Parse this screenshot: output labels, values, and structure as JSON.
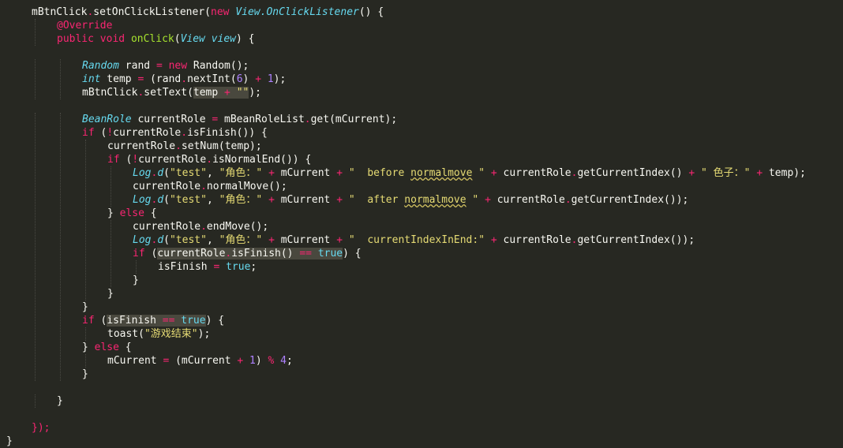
{
  "theme": {
    "background": "#272822",
    "plain": "#f8f8f2",
    "keyword": "#f92672",
    "type": "#66d9ef",
    "method": "#a6e22e",
    "string": "#e6db74",
    "number": "#ae81ff",
    "annotation": "#f92672",
    "highlight": "#49483e"
  },
  "code_lines": [
    {
      "indent": 1,
      "tokens": [
        {
          "t": "mBtnClick",
          "c": "plain"
        },
        {
          "t": ".",
          "c": "keyword"
        },
        {
          "t": "setOnClickListener(",
          "c": "plain"
        },
        {
          "t": "new",
          "c": "keyword"
        },
        {
          "t": " ",
          "c": "plain"
        },
        {
          "t": "View.OnClickListener",
          "c": "type",
          "i": true
        },
        {
          "t": "() {",
          "c": "plain"
        }
      ]
    },
    {
      "indent": 2,
      "tokens": [
        {
          "t": "@Override",
          "c": "annotation"
        }
      ]
    },
    {
      "indent": 2,
      "tokens": [
        {
          "t": "public",
          "c": "keyword"
        },
        {
          "t": " ",
          "c": "plain"
        },
        {
          "t": "void",
          "c": "keyword"
        },
        {
          "t": " ",
          "c": "plain"
        },
        {
          "t": "onClick",
          "c": "method"
        },
        {
          "t": "(",
          "c": "plain"
        },
        {
          "t": "View",
          "c": "type",
          "i": true
        },
        {
          "t": " ",
          "c": "plain"
        },
        {
          "t": "view",
          "c": "type",
          "i": true
        },
        {
          "t": ") {",
          "c": "plain"
        }
      ]
    },
    {
      "indent": 0,
      "tokens": []
    },
    {
      "indent": 3,
      "tokens": [
        {
          "t": "Random",
          "c": "type",
          "i": true
        },
        {
          "t": " rand ",
          "c": "plain"
        },
        {
          "t": "=",
          "c": "keyword"
        },
        {
          "t": " ",
          "c": "plain"
        },
        {
          "t": "new",
          "c": "keyword"
        },
        {
          "t": " Random();",
          "c": "plain"
        }
      ]
    },
    {
      "indent": 3,
      "tokens": [
        {
          "t": "int",
          "c": "type",
          "i": true
        },
        {
          "t": " temp ",
          "c": "plain"
        },
        {
          "t": "=",
          "c": "keyword"
        },
        {
          "t": " (rand",
          "c": "plain"
        },
        {
          "t": ".",
          "c": "keyword"
        },
        {
          "t": "nextInt(",
          "c": "plain"
        },
        {
          "t": "6",
          "c": "number"
        },
        {
          "t": ") ",
          "c": "plain"
        },
        {
          "t": "+",
          "c": "keyword"
        },
        {
          "t": " ",
          "c": "plain"
        },
        {
          "t": "1",
          "c": "number"
        },
        {
          "t": ");",
          "c": "plain"
        }
      ]
    },
    {
      "indent": 3,
      "tokens": [
        {
          "t": "mBtnClick",
          "c": "plain"
        },
        {
          "t": ".",
          "c": "keyword"
        },
        {
          "t": "setText(",
          "c": "plain"
        },
        {
          "t": "temp ",
          "c": "plain",
          "h": true
        },
        {
          "t": "+",
          "c": "keyword",
          "h": true
        },
        {
          "t": " ",
          "c": "plain",
          "h": true
        },
        {
          "t": "\"\"",
          "c": "string",
          "h": true
        },
        {
          "t": ");",
          "c": "plain"
        }
      ]
    },
    {
      "indent": 0,
      "tokens": []
    },
    {
      "indent": 3,
      "tokens": [
        {
          "t": "BeanRole",
          "c": "type",
          "i": true
        },
        {
          "t": " currentRole ",
          "c": "plain"
        },
        {
          "t": "=",
          "c": "keyword"
        },
        {
          "t": " mBeanRoleList",
          "c": "plain"
        },
        {
          "t": ".",
          "c": "keyword"
        },
        {
          "t": "get(mCurrent);",
          "c": "plain"
        }
      ]
    },
    {
      "indent": 3,
      "tokens": [
        {
          "t": "if",
          "c": "keyword"
        },
        {
          "t": " (",
          "c": "plain"
        },
        {
          "t": "!",
          "c": "keyword"
        },
        {
          "t": "currentRole",
          "c": "plain"
        },
        {
          "t": ".",
          "c": "keyword"
        },
        {
          "t": "isFinish()) {",
          "c": "plain"
        }
      ]
    },
    {
      "indent": 4,
      "tokens": [
        {
          "t": "currentRole",
          "c": "plain"
        },
        {
          "t": ".",
          "c": "keyword"
        },
        {
          "t": "setNum(temp);",
          "c": "plain"
        }
      ]
    },
    {
      "indent": 4,
      "tokens": [
        {
          "t": "if",
          "c": "keyword"
        },
        {
          "t": " (",
          "c": "plain"
        },
        {
          "t": "!",
          "c": "keyword"
        },
        {
          "t": "currentRole",
          "c": "plain"
        },
        {
          "t": ".",
          "c": "keyword"
        },
        {
          "t": "isNormalEnd()) {",
          "c": "plain"
        }
      ]
    },
    {
      "indent": 5,
      "tokens": [
        {
          "t": "Log",
          "c": "type",
          "i": true
        },
        {
          "t": ".",
          "c": "keyword"
        },
        {
          "t": "d",
          "c": "type",
          "i": true
        },
        {
          "t": "(",
          "c": "plain"
        },
        {
          "t": "\"test\"",
          "c": "string"
        },
        {
          "t": ", ",
          "c": "plain"
        },
        {
          "t": "\"角色：\"",
          "c": "string"
        },
        {
          "t": " ",
          "c": "plain"
        },
        {
          "t": "+",
          "c": "keyword"
        },
        {
          "t": " mCurrent ",
          "c": "plain"
        },
        {
          "t": "+",
          "c": "keyword"
        },
        {
          "t": " ",
          "c": "plain"
        },
        {
          "t": "\"  before ",
          "c": "string"
        },
        {
          "t": "normalmove",
          "c": "string",
          "u": true
        },
        {
          "t": " \"",
          "c": "string"
        },
        {
          "t": " ",
          "c": "plain"
        },
        {
          "t": "+",
          "c": "keyword"
        },
        {
          "t": " currentRole",
          "c": "plain"
        },
        {
          "t": ".",
          "c": "keyword"
        },
        {
          "t": "getCurrentIndex() ",
          "c": "plain"
        },
        {
          "t": "+",
          "c": "keyword"
        },
        {
          "t": " ",
          "c": "plain"
        },
        {
          "t": "\" 色子：\"",
          "c": "string"
        },
        {
          "t": " ",
          "c": "plain"
        },
        {
          "t": "+",
          "c": "keyword"
        },
        {
          "t": " temp);",
          "c": "plain"
        }
      ]
    },
    {
      "indent": 5,
      "tokens": [
        {
          "t": "currentRole",
          "c": "plain"
        },
        {
          "t": ".",
          "c": "keyword"
        },
        {
          "t": "normalMove();",
          "c": "plain"
        }
      ]
    },
    {
      "indent": 5,
      "tokens": [
        {
          "t": "Log",
          "c": "type",
          "i": true
        },
        {
          "t": ".",
          "c": "keyword"
        },
        {
          "t": "d",
          "c": "type",
          "i": true
        },
        {
          "t": "(",
          "c": "plain"
        },
        {
          "t": "\"test\"",
          "c": "string"
        },
        {
          "t": ", ",
          "c": "plain"
        },
        {
          "t": "\"角色：\"",
          "c": "string"
        },
        {
          "t": " ",
          "c": "plain"
        },
        {
          "t": "+",
          "c": "keyword"
        },
        {
          "t": " mCurrent ",
          "c": "plain"
        },
        {
          "t": "+",
          "c": "keyword"
        },
        {
          "t": " ",
          "c": "plain"
        },
        {
          "t": "\"  after ",
          "c": "string"
        },
        {
          "t": "normalmove",
          "c": "string",
          "u": true
        },
        {
          "t": " \"",
          "c": "string"
        },
        {
          "t": " ",
          "c": "plain"
        },
        {
          "t": "+",
          "c": "keyword"
        },
        {
          "t": " currentRole",
          "c": "plain"
        },
        {
          "t": ".",
          "c": "keyword"
        },
        {
          "t": "getCurrentIndex());",
          "c": "plain"
        }
      ]
    },
    {
      "indent": 4,
      "tokens": [
        {
          "t": "} ",
          "c": "plain"
        },
        {
          "t": "else",
          "c": "keyword"
        },
        {
          "t": " {",
          "c": "plain"
        }
      ]
    },
    {
      "indent": 5,
      "tokens": [
        {
          "t": "currentRole",
          "c": "plain"
        },
        {
          "t": ".",
          "c": "keyword"
        },
        {
          "t": "endMove();",
          "c": "plain"
        }
      ]
    },
    {
      "indent": 5,
      "tokens": [
        {
          "t": "Log",
          "c": "type",
          "i": true
        },
        {
          "t": ".",
          "c": "keyword"
        },
        {
          "t": "d",
          "c": "type",
          "i": true
        },
        {
          "t": "(",
          "c": "plain"
        },
        {
          "t": "\"test\"",
          "c": "string"
        },
        {
          "t": ", ",
          "c": "plain"
        },
        {
          "t": "\"角色：\"",
          "c": "string"
        },
        {
          "t": " ",
          "c": "plain"
        },
        {
          "t": "+",
          "c": "keyword"
        },
        {
          "t": " mCurrent ",
          "c": "plain"
        },
        {
          "t": "+",
          "c": "keyword"
        },
        {
          "t": " ",
          "c": "plain"
        },
        {
          "t": "\"  currentIndexInEnd:\"",
          "c": "string"
        },
        {
          "t": " ",
          "c": "plain"
        },
        {
          "t": "+",
          "c": "keyword"
        },
        {
          "t": " currentRole",
          "c": "plain"
        },
        {
          "t": ".",
          "c": "keyword"
        },
        {
          "t": "getCurrentIndex());",
          "c": "plain"
        }
      ]
    },
    {
      "indent": 5,
      "tokens": [
        {
          "t": "if",
          "c": "keyword"
        },
        {
          "t": " (",
          "c": "plain"
        },
        {
          "t": "currentRole",
          "c": "plain",
          "h": true
        },
        {
          "t": ".",
          "c": "keyword",
          "h": true
        },
        {
          "t": "isFinish() ",
          "c": "plain",
          "h": true
        },
        {
          "t": "==",
          "c": "keyword",
          "h": true
        },
        {
          "t": " ",
          "c": "plain",
          "h": true
        },
        {
          "t": "true",
          "c": "type",
          "h": true
        },
        {
          "t": ") {",
          "c": "plain"
        }
      ]
    },
    {
      "indent": 6,
      "tokens": [
        {
          "t": "isFinish ",
          "c": "plain"
        },
        {
          "t": "=",
          "c": "keyword"
        },
        {
          "t": " ",
          "c": "plain"
        },
        {
          "t": "true",
          "c": "type"
        },
        {
          "t": ";",
          "c": "plain"
        }
      ]
    },
    {
      "indent": 5,
      "tokens": [
        {
          "t": "}",
          "c": "plain"
        }
      ]
    },
    {
      "indent": 4,
      "tokens": [
        {
          "t": "}",
          "c": "plain"
        }
      ]
    },
    {
      "indent": 3,
      "tokens": [
        {
          "t": "}",
          "c": "plain"
        }
      ]
    },
    {
      "indent": 3,
      "tokens": [
        {
          "t": "if",
          "c": "keyword"
        },
        {
          "t": " (",
          "c": "plain"
        },
        {
          "t": "isFinish ",
          "c": "plain",
          "h": true
        },
        {
          "t": "==",
          "c": "keyword",
          "h": true
        },
        {
          "t": " ",
          "c": "plain",
          "h": true
        },
        {
          "t": "true",
          "c": "type",
          "h": true
        },
        {
          "t": ") {",
          "c": "plain"
        }
      ]
    },
    {
      "indent": 4,
      "tokens": [
        {
          "t": "toast(",
          "c": "plain"
        },
        {
          "t": "\"游戏结束\"",
          "c": "string"
        },
        {
          "t": ");",
          "c": "plain"
        }
      ]
    },
    {
      "indent": 3,
      "tokens": [
        {
          "t": "} ",
          "c": "plain"
        },
        {
          "t": "else",
          "c": "keyword"
        },
        {
          "t": " {",
          "c": "plain"
        }
      ]
    },
    {
      "indent": 4,
      "tokens": [
        {
          "t": "mCurrent ",
          "c": "plain"
        },
        {
          "t": "=",
          "c": "keyword"
        },
        {
          "t": " (mCurrent ",
          "c": "plain"
        },
        {
          "t": "+",
          "c": "keyword"
        },
        {
          "t": " ",
          "c": "plain"
        },
        {
          "t": "1",
          "c": "number"
        },
        {
          "t": ") ",
          "c": "plain"
        },
        {
          "t": "%",
          "c": "keyword"
        },
        {
          "t": " ",
          "c": "plain"
        },
        {
          "t": "4",
          "c": "number"
        },
        {
          "t": ";",
          "c": "plain"
        }
      ]
    },
    {
      "indent": 3,
      "tokens": [
        {
          "t": "}",
          "c": "plain"
        }
      ]
    },
    {
      "indent": 0,
      "tokens": []
    },
    {
      "indent": 2,
      "tokens": [
        {
          "t": "}",
          "c": "plain"
        }
      ]
    },
    {
      "indent": 0,
      "tokens": []
    },
    {
      "indent": 1,
      "tokens": [
        {
          "t": "});",
          "c": "keyword"
        }
      ]
    },
    {
      "indent": 0,
      "tokens": [
        {
          "t": "}",
          "c": "plain"
        }
      ]
    }
  ]
}
